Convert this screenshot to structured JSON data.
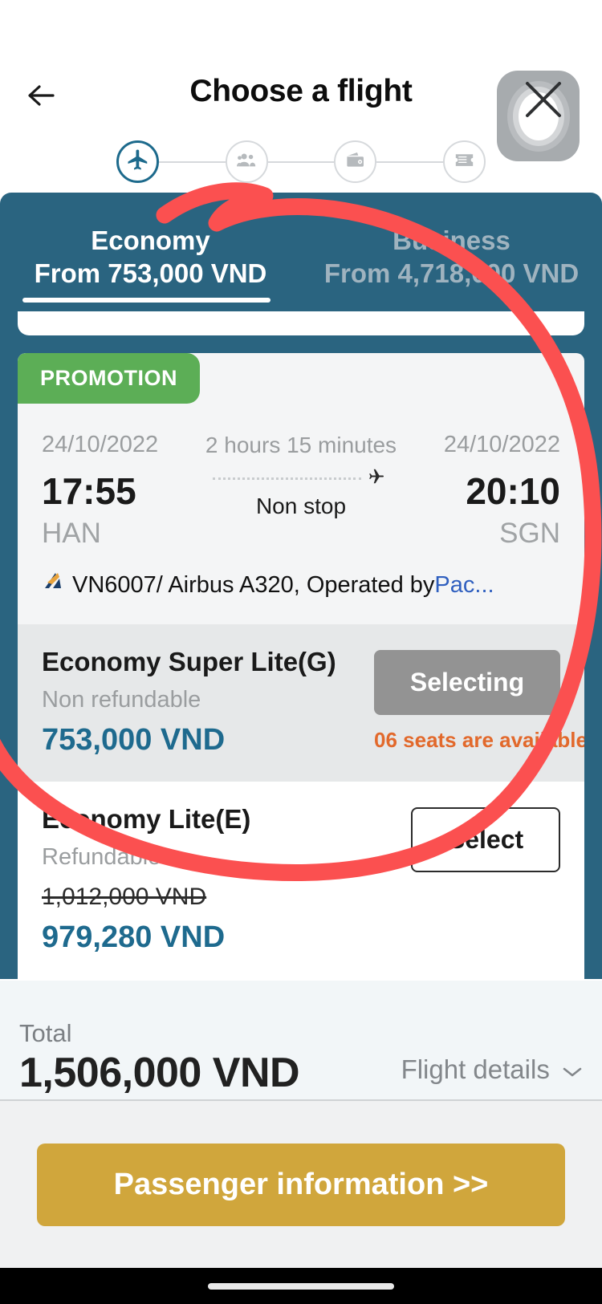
{
  "header": {
    "title": "Choose a flight",
    "back_icon": "back-arrow-icon",
    "close_icon": "close-x-icon"
  },
  "stepper": {
    "steps": [
      {
        "id": "flight",
        "icon": "airplane-icon",
        "active": true
      },
      {
        "id": "passengers",
        "icon": "passengers-icon",
        "active": false
      },
      {
        "id": "payment",
        "icon": "wallet-icon",
        "active": false
      },
      {
        "id": "ticket",
        "icon": "ticket-icon",
        "active": false
      }
    ]
  },
  "cabin_tabs": [
    {
      "name": "Economy",
      "price": "From 753,000 VND",
      "active": true
    },
    {
      "name": "Business",
      "price": "From 4,718,000 VND",
      "active": false
    }
  ],
  "flight_card": {
    "promotion_badge": "PROMOTION",
    "depart": {
      "date": "24/10/2022",
      "time": "17:55",
      "airport": "HAN"
    },
    "arrive": {
      "date": "24/10/2022",
      "time": "20:10",
      "airport": "SGN"
    },
    "duration": "2 hours 15 minutes",
    "stops": "Non stop",
    "aircraft_line": "VN6007/ Airbus A320, Operated by ",
    "operator_link": "Pac...",
    "fares": [
      {
        "name": "Economy Super Lite(G)",
        "refund": "Non refundable",
        "old_price": "",
        "price": "753,000 VND",
        "button": "Selecting",
        "seats": "06 seats are available",
        "state": "selected"
      },
      {
        "name": "Economy Lite(E)",
        "refund": "Refundable",
        "old_price": "1,012,000 VND",
        "price": "979,280 VND",
        "button": "Select",
        "seats": "",
        "state": "available"
      }
    ]
  },
  "total_bar": {
    "label": "Total",
    "amount": "1,506,000 VND",
    "details_link": "Flight details",
    "chevron": "⌄"
  },
  "cta": {
    "label": "Passenger information >>"
  },
  "colors": {
    "teal": "#2a6480",
    "promo_green": "#5cae56",
    "price_blue": "#1e6a8e",
    "seats_orange": "#e2692c",
    "cta_gold": "#d0a63c",
    "annotation_red": "#fb5050",
    "operator_link": "#2f5fbf"
  }
}
